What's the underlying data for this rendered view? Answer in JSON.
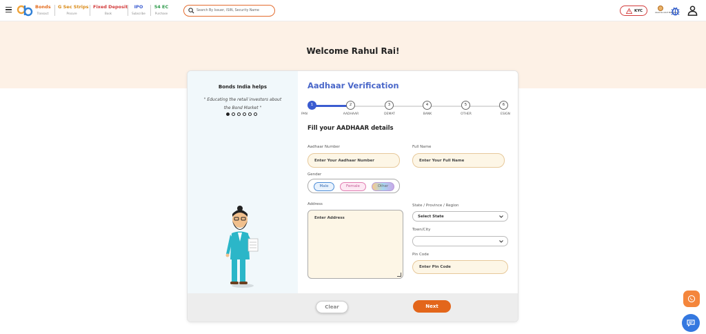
{
  "header": {
    "nav": [
      {
        "title": "Bonds",
        "sub": "Transact",
        "color": "#e36b1d"
      },
      {
        "title": "G Sec Strips",
        "sub": "Procure",
        "color": "#d98a17"
      },
      {
        "title": "Fixed Deposit",
        "sub": "Book",
        "color": "#d23a3a"
      },
      {
        "title": "IPO",
        "sub": "Subscribe",
        "color": "#3a5bd0"
      },
      {
        "title": "54 EC",
        "sub": "Purchase",
        "color": "#2d9a4a"
      }
    ],
    "search_placeholder": "Search By Issuer, ISIN, Security Name",
    "kyc_label": "KYC",
    "badge_text": "Azadi Ka Amrit Mahotsav"
  },
  "hero": {
    "welcome": "Welcome Rahul Rai!"
  },
  "left": {
    "helps_title": "Bonds India helps",
    "quote": "\" Educating the retail investors about the Bond Market \"",
    "carousel_count": 6,
    "carousel_active": 0
  },
  "form": {
    "title": "Aadhaar Verification",
    "steps": [
      {
        "num": "1",
        "label": "PAN"
      },
      {
        "num": "2",
        "label": "AADHAAR"
      },
      {
        "num": "3",
        "label": "DEMAT"
      },
      {
        "num": "4",
        "label": "BANK"
      },
      {
        "num": "5",
        "label": "OTHER"
      },
      {
        "num": "6",
        "label": "ESIGN"
      }
    ],
    "current_step": 2,
    "subtitle": "Fill your AADHAAR details",
    "aadhaar_label": "Aadhaar Number",
    "aadhaar_placeholder": "Enter Your Aadhaar Number",
    "fullname_label": "Full Name",
    "fullname_placeholder": "Enter Your Full Name",
    "gender_label": "Gender",
    "gender_options": [
      "Male",
      "Female",
      "Other"
    ],
    "address_label": "Address",
    "address_placeholder": "Enter Address",
    "state_label": "State / Province / Region",
    "state_value": "Select State",
    "city_label": "Town/City",
    "city_value": "",
    "pin_label": "Pin Code",
    "pin_placeholder": "Enter Pin Code"
  },
  "footer": {
    "clear_label": "Clear",
    "next_label": "Next"
  },
  "colors": {
    "accent": "#e3661b",
    "primary": "#3a5bd0",
    "hero_bg": "#fdf1e6"
  }
}
